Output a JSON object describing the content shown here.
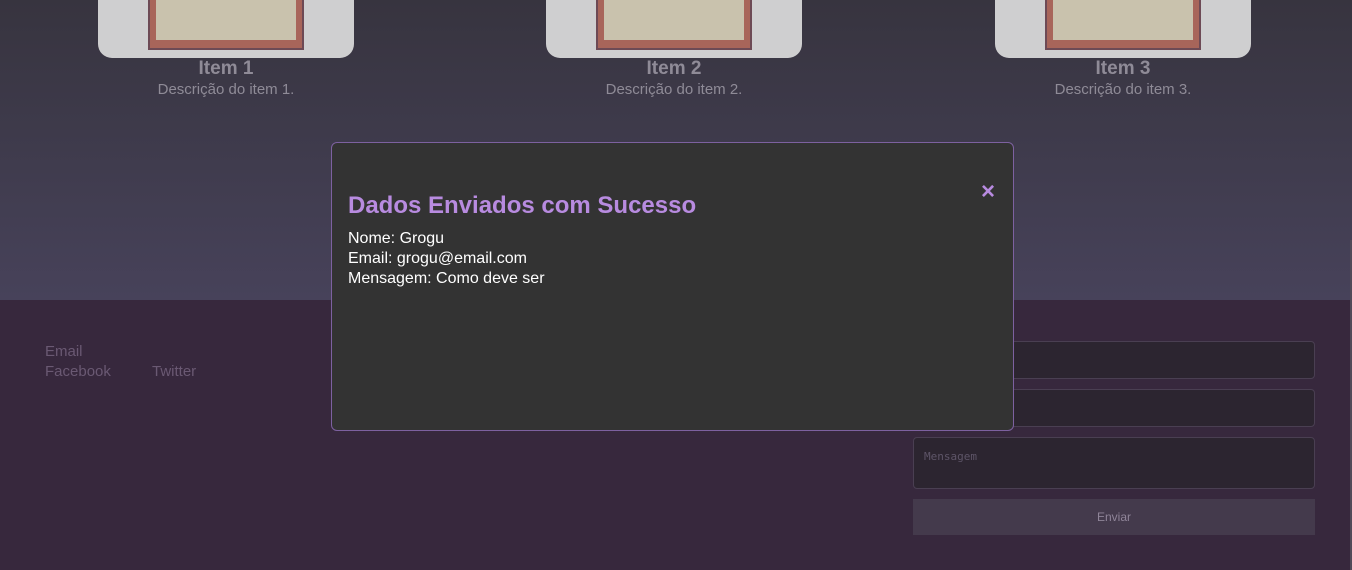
{
  "gallery": {
    "items": [
      {
        "title": "Item 1",
        "description": "Descrição do item 1."
      },
      {
        "title": "Item 2",
        "description": "Descrição do item 2."
      },
      {
        "title": "Item 3",
        "description": "Descrição do item 3."
      }
    ]
  },
  "footer": {
    "links": {
      "email": "Email",
      "facebook": "Facebook",
      "twitter": "Twitter"
    },
    "form": {
      "message_placeholder": "Mensagem",
      "submit_label": "Enviar"
    }
  },
  "modal": {
    "title": "Dados Enviados com Sucesso",
    "close_icon": "×",
    "lines": {
      "name": "Nome: Grogu",
      "email": "Email: grogu@email.com",
      "message": "Mensagem: Como deve ser"
    }
  },
  "colors": {
    "accent": "#b88be0",
    "overlay_dim": "#3a3742",
    "footer_bg": "#37283d",
    "modal_bg": "#333333"
  }
}
